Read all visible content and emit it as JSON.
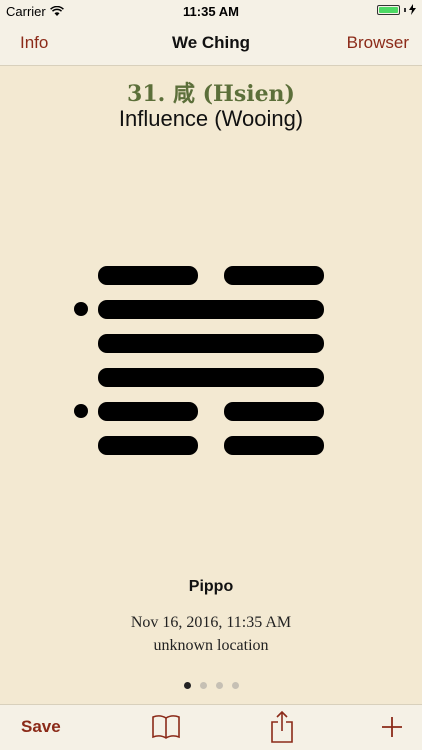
{
  "status": {
    "carrier": "Carrier",
    "time": "11:35 AM"
  },
  "nav": {
    "left": "Info",
    "title": "We Ching",
    "right": "Browser"
  },
  "hexagram": {
    "number_title": "31. 咸 (Hsien)",
    "name": "Influence (Wooing)",
    "lines_top_to_bottom": [
      "broken",
      "solid",
      "solid",
      "solid",
      "broken",
      "broken"
    ],
    "changing_lines_top_to_bottom": [
      false,
      true,
      false,
      false,
      true,
      false
    ]
  },
  "reading": {
    "person": "Pippo",
    "datetime": "Nov 16, 2016, 11:35 AM",
    "location": "unknown location"
  },
  "pager": {
    "count": 4,
    "active": 0
  },
  "toolbar": {
    "save_label": "Save"
  },
  "colors": {
    "accent": "#8b2a18",
    "title_green": "#5c6f3a",
    "background": "#f3e9d2"
  }
}
